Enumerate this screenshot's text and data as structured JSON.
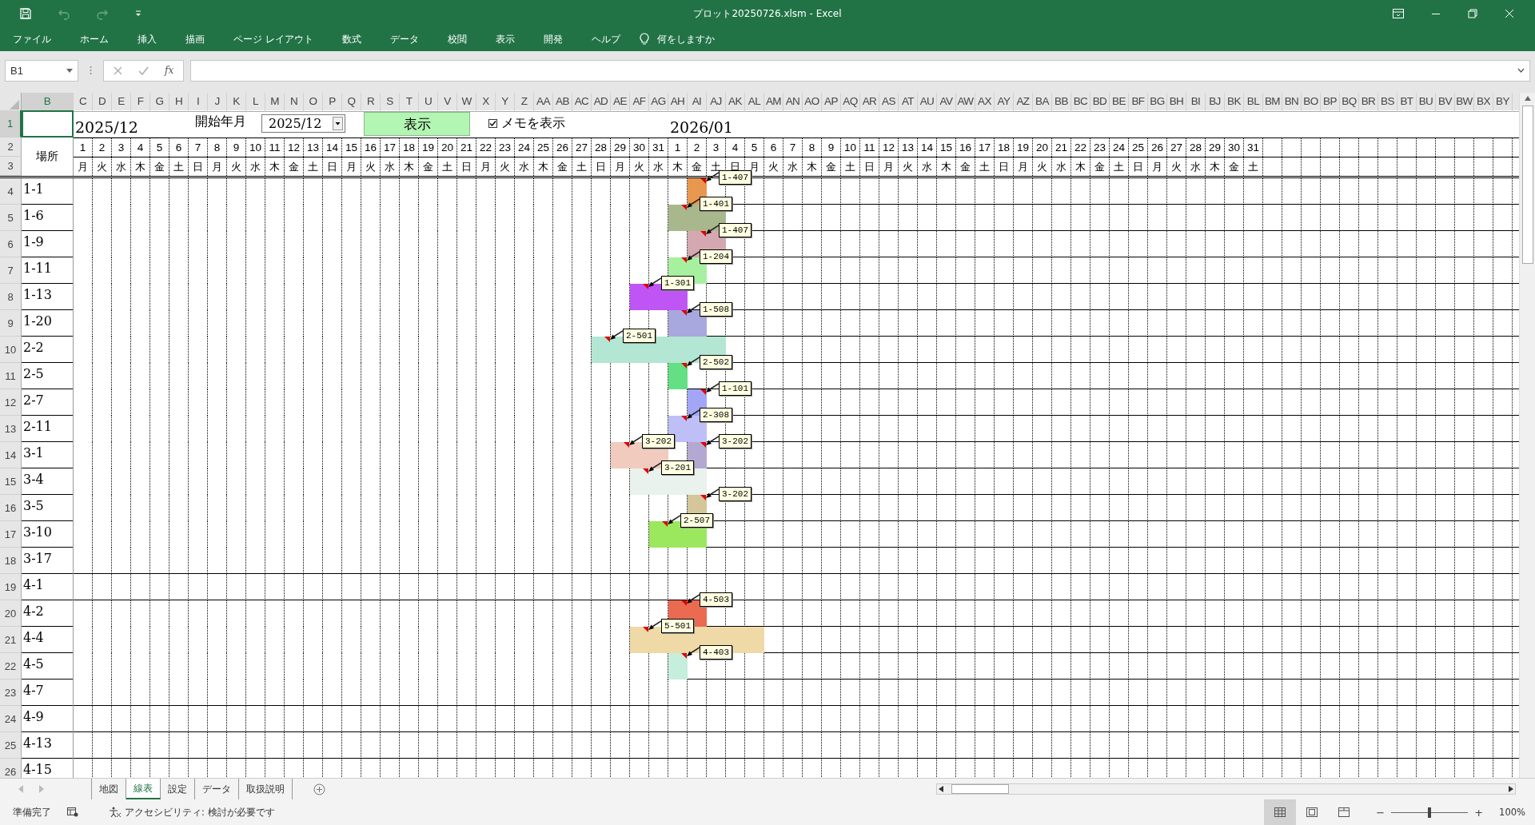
{
  "window": {
    "title": "プロット20250726.xlsm  -  Excel"
  },
  "menu": [
    "ファイル",
    "ホーム",
    "挿入",
    "描画",
    "ページ レイアウト",
    "数式",
    "データ",
    "校閲",
    "表示",
    "開発",
    "ヘルプ"
  ],
  "tell_me": "何をしますか",
  "name_box": "B1",
  "function_label": "fx",
  "column_headers": [
    "B",
    "C",
    "D",
    "E",
    "F",
    "G",
    "H",
    "I",
    "J",
    "K",
    "L",
    "M",
    "N",
    "O",
    "P",
    "Q",
    "R",
    "S",
    "T",
    "U",
    "V",
    "W",
    "X",
    "Y",
    "Z",
    "AA",
    "AB",
    "AC",
    "AD",
    "AE",
    "AF",
    "AG",
    "AH",
    "AI",
    "AJ",
    "AK",
    "AL",
    "AM",
    "AN",
    "AO",
    "AP",
    "AQ",
    "AR",
    "AS",
    "AT",
    "AU",
    "AV",
    "AW",
    "AX",
    "AY",
    "AZ",
    "BA",
    "BB",
    "BC",
    "BD",
    "BE",
    "BF",
    "BG",
    "BH",
    "BI",
    "BJ",
    "BK",
    "BL",
    "BM",
    "BN",
    "BO",
    "BP",
    "BQ",
    "BR",
    "BS",
    "BT",
    "BU",
    "BV",
    "BW",
    "BX",
    "BY"
  ],
  "row_headers": [
    "1",
    "2",
    "3",
    "4",
    "5",
    "6",
    "7",
    "8",
    "9",
    "10",
    "11",
    "12",
    "13",
    "14",
    "15",
    "16",
    "17",
    "18",
    "19",
    "20",
    "21",
    "22",
    "23",
    "24",
    "25",
    "26"
  ],
  "header_block": {
    "cell_selected": true,
    "month_start": "2025/12",
    "start_label": "開始年月",
    "start_select": "2025/12",
    "show_button": "表示",
    "memo_checkbox": {
      "label": "メモを表示",
      "checked": true
    },
    "month_next": "2026/01",
    "location_header": "場所",
    "day_numbers": [
      "1",
      "2",
      "3",
      "4",
      "5",
      "6",
      "7",
      "8",
      "9",
      "10",
      "11",
      "12",
      "13",
      "14",
      "15",
      "16",
      "17",
      "18",
      "19",
      "20",
      "21",
      "22",
      "23",
      "24",
      "25",
      "26",
      "27",
      "28",
      "29",
      "30",
      "31",
      "1",
      "2",
      "3",
      "4",
      "5",
      "6",
      "7",
      "8",
      "9",
      "10",
      "11",
      "12",
      "13",
      "14",
      "15",
      "16",
      "17",
      "18",
      "19",
      "20",
      "21",
      "22",
      "23",
      "24",
      "25",
      "26",
      "27",
      "28",
      "29",
      "30",
      "31"
    ],
    "weekdays": [
      "月",
      "火",
      "水",
      "木",
      "金",
      "土",
      "日",
      "月",
      "火",
      "水",
      "木",
      "金",
      "土",
      "日",
      "月",
      "火",
      "水",
      "木",
      "金",
      "土",
      "日",
      "月",
      "火",
      "水",
      "木",
      "金",
      "土",
      "日",
      "月",
      "火",
      "水",
      "木",
      "金",
      "土",
      "日",
      "月",
      "火",
      "水",
      "木",
      "金",
      "土",
      "日",
      "月",
      "火",
      "水",
      "木",
      "金",
      "土",
      "日",
      "月",
      "火",
      "水",
      "木",
      "金",
      "土",
      "日",
      "月",
      "火",
      "水",
      "木",
      "金",
      "土"
    ]
  },
  "locations": [
    {
      "label": "1-1",
      "cells": [
        {
          "color": "#ffffff"
        },
        {
          "color": "#ffffff"
        },
        {
          "color": "#ffffff"
        },
        {
          "color": "#ffffff"
        },
        {
          "color": "#ffffff"
        },
        {
          "color": "#ffffff"
        },
        {
          "color": "#ffffff"
        },
        {
          "color": "#ffffff"
        },
        {
          "color": "#ffffff"
        },
        {
          "color": "#ffffff"
        },
        {
          "color": "#ffffff"
        },
        {
          "color": "#ffffff"
        },
        {
          "color": "#ffffff"
        },
        {
          "color": "#ffffff"
        },
        {
          "color": "#ffffff"
        },
        {
          "color": "#ffffff"
        },
        {
          "color": "#ffffff"
        },
        {
          "color": "#ffffff"
        },
        {
          "color": "#ffffff"
        },
        {
          "color": "#ffffff"
        },
        {
          "color": "#ffffff"
        },
        {
          "color": "#ffffff"
        },
        {
          "color": "#ffffff"
        },
        {
          "color": "#ffffff"
        },
        {
          "color": "#ffffff"
        },
        {
          "color": "#ffffff"
        },
        {
          "color": "#ffffff"
        },
        {
          "color": "#ffffff"
        },
        {
          "color": "#ffffff"
        },
        {
          "color": "#ffffff"
        },
        {
          "color": "#ffffff"
        },
        {
          "color": "#ffffff"
        },
        {
          "color": "#e8984e",
          "memo": "1-407"
        }
      ]
    },
    {
      "label": "1-6",
      "cells": [
        {
          "color": "#ffffff"
        },
        {
          "color": "#ffffff"
        },
        {
          "color": "#ffffff"
        },
        {
          "color": "#ffffff"
        },
        {
          "color": "#ffffff"
        },
        {
          "color": "#ffffff"
        },
        {
          "color": "#ffffff"
        },
        {
          "color": "#ffffff"
        },
        {
          "color": "#ffffff"
        },
        {
          "color": "#ffffff"
        },
        {
          "color": "#ffffff"
        },
        {
          "color": "#ffffff"
        },
        {
          "color": "#ffffff"
        },
        {
          "color": "#ffffff"
        },
        {
          "color": "#ffffff"
        },
        {
          "color": "#ffffff"
        },
        {
          "color": "#ffffff"
        },
        {
          "color": "#ffffff"
        },
        {
          "color": "#ffffff"
        },
        {
          "color": "#ffffff"
        },
        {
          "color": "#ffffff"
        },
        {
          "color": "#ffffff"
        },
        {
          "color": "#ffffff"
        },
        {
          "color": "#ffffff"
        },
        {
          "color": "#ffffff"
        },
        {
          "color": "#ffffff"
        },
        {
          "color": "#ffffff"
        },
        {
          "color": "#ffffff"
        },
        {
          "color": "#ffffff"
        },
        {
          "color": "#ffffff"
        },
        {
          "color": "#ffffff"
        },
        {
          "color": "#a9b88c",
          "memo": "1-401"
        },
        {
          "color": "#a9b88c"
        },
        {
          "color": "#a9b88c"
        }
      ]
    },
    {
      "label": "1-9",
      "cells": [
        {
          "color": "#ffffff"
        },
        {
          "color": "#ffffff"
        },
        {
          "color": "#ffffff"
        },
        {
          "color": "#ffffff"
        },
        {
          "color": "#ffffff"
        },
        {
          "color": "#ffffff"
        },
        {
          "color": "#ffffff"
        },
        {
          "color": "#ffffff"
        },
        {
          "color": "#ffffff"
        },
        {
          "color": "#ffffff"
        },
        {
          "color": "#ffffff"
        },
        {
          "color": "#ffffff"
        },
        {
          "color": "#ffffff"
        },
        {
          "color": "#ffffff"
        },
        {
          "color": "#ffffff"
        },
        {
          "color": "#ffffff"
        },
        {
          "color": "#ffffff"
        },
        {
          "color": "#ffffff"
        },
        {
          "color": "#ffffff"
        },
        {
          "color": "#ffffff"
        },
        {
          "color": "#ffffff"
        },
        {
          "color": "#ffffff"
        },
        {
          "color": "#ffffff"
        },
        {
          "color": "#ffffff"
        },
        {
          "color": "#ffffff"
        },
        {
          "color": "#ffffff"
        },
        {
          "color": "#ffffff"
        },
        {
          "color": "#ffffff"
        },
        {
          "color": "#ffffff"
        },
        {
          "color": "#ffffff"
        },
        {
          "color": "#ffffff"
        },
        {
          "color": "#ffffff"
        },
        {
          "color": "#d5a7b0",
          "memo": "1-407"
        },
        {
          "color": "#d5a7b0"
        }
      ]
    },
    {
      "label": "1-11",
      "cells": [
        {
          "color": "#ffffff"
        },
        {
          "color": "#ffffff"
        },
        {
          "color": "#ffffff"
        },
        {
          "color": "#ffffff"
        },
        {
          "color": "#ffffff"
        },
        {
          "color": "#ffffff"
        },
        {
          "color": "#ffffff"
        },
        {
          "color": "#ffffff"
        },
        {
          "color": "#ffffff"
        },
        {
          "color": "#ffffff"
        },
        {
          "color": "#ffffff"
        },
        {
          "color": "#ffffff"
        },
        {
          "color": "#ffffff"
        },
        {
          "color": "#ffffff"
        },
        {
          "color": "#ffffff"
        },
        {
          "color": "#ffffff"
        },
        {
          "color": "#ffffff"
        },
        {
          "color": "#ffffff"
        },
        {
          "color": "#ffffff"
        },
        {
          "color": "#ffffff"
        },
        {
          "color": "#ffffff"
        },
        {
          "color": "#ffffff"
        },
        {
          "color": "#ffffff"
        },
        {
          "color": "#ffffff"
        },
        {
          "color": "#ffffff"
        },
        {
          "color": "#ffffff"
        },
        {
          "color": "#ffffff"
        },
        {
          "color": "#ffffff"
        },
        {
          "color": "#ffffff"
        },
        {
          "color": "#ffffff"
        },
        {
          "color": "#ffffff"
        },
        {
          "color": "#a6f0a0",
          "memo": "1-204"
        },
        {
          "color": "#a6f0a0"
        }
      ]
    },
    {
      "label": "1-13",
      "cells": [
        {
          "color": "#ffffff"
        },
        {
          "color": "#ffffff"
        },
        {
          "color": "#ffffff"
        },
        {
          "color": "#ffffff"
        },
        {
          "color": "#ffffff"
        },
        {
          "color": "#ffffff"
        },
        {
          "color": "#ffffff"
        },
        {
          "color": "#ffffff"
        },
        {
          "color": "#ffffff"
        },
        {
          "color": "#ffffff"
        },
        {
          "color": "#ffffff"
        },
        {
          "color": "#ffffff"
        },
        {
          "color": "#ffffff"
        },
        {
          "color": "#ffffff"
        },
        {
          "color": "#ffffff"
        },
        {
          "color": "#ffffff"
        },
        {
          "color": "#ffffff"
        },
        {
          "color": "#ffffff"
        },
        {
          "color": "#ffffff"
        },
        {
          "color": "#ffffff"
        },
        {
          "color": "#ffffff"
        },
        {
          "color": "#ffffff"
        },
        {
          "color": "#ffffff"
        },
        {
          "color": "#ffffff"
        },
        {
          "color": "#ffffff"
        },
        {
          "color": "#ffffff"
        },
        {
          "color": "#ffffff"
        },
        {
          "color": "#ffffff"
        },
        {
          "color": "#ffffff"
        },
        {
          "color": "#bf55f5",
          "memo": "1-301"
        },
        {
          "color": "#bf55f5"
        },
        {
          "color": "#bf55f5"
        }
      ]
    },
    {
      "label": "1-20",
      "cells": [
        {
          "color": "#ffffff"
        },
        {
          "color": "#ffffff"
        },
        {
          "color": "#ffffff"
        },
        {
          "color": "#ffffff"
        },
        {
          "color": "#ffffff"
        },
        {
          "color": "#ffffff"
        },
        {
          "color": "#ffffff"
        },
        {
          "color": "#ffffff"
        },
        {
          "color": "#ffffff"
        },
        {
          "color": "#ffffff"
        },
        {
          "color": "#ffffff"
        },
        {
          "color": "#ffffff"
        },
        {
          "color": "#ffffff"
        },
        {
          "color": "#ffffff"
        },
        {
          "color": "#ffffff"
        },
        {
          "color": "#ffffff"
        },
        {
          "color": "#ffffff"
        },
        {
          "color": "#ffffff"
        },
        {
          "color": "#ffffff"
        },
        {
          "color": "#ffffff"
        },
        {
          "color": "#ffffff"
        },
        {
          "color": "#ffffff"
        },
        {
          "color": "#ffffff"
        },
        {
          "color": "#ffffff"
        },
        {
          "color": "#ffffff"
        },
        {
          "color": "#ffffff"
        },
        {
          "color": "#ffffff"
        },
        {
          "color": "#ffffff"
        },
        {
          "color": "#ffffff"
        },
        {
          "color": "#ffffff"
        },
        {
          "color": "#ffffff"
        },
        {
          "color": "#a8a8df",
          "memo": "1-508"
        },
        {
          "color": "#a8a8df"
        }
      ]
    },
    {
      "label": "2-2",
      "cells": [
        {
          "color": "#ffffff"
        },
        {
          "color": "#ffffff"
        },
        {
          "color": "#ffffff"
        },
        {
          "color": "#ffffff"
        },
        {
          "color": "#ffffff"
        },
        {
          "color": "#ffffff"
        },
        {
          "color": "#ffffff"
        },
        {
          "color": "#ffffff"
        },
        {
          "color": "#ffffff"
        },
        {
          "color": "#ffffff"
        },
        {
          "color": "#ffffff"
        },
        {
          "color": "#ffffff"
        },
        {
          "color": "#ffffff"
        },
        {
          "color": "#ffffff"
        },
        {
          "color": "#ffffff"
        },
        {
          "color": "#ffffff"
        },
        {
          "color": "#ffffff"
        },
        {
          "color": "#ffffff"
        },
        {
          "color": "#ffffff"
        },
        {
          "color": "#ffffff"
        },
        {
          "color": "#ffffff"
        },
        {
          "color": "#ffffff"
        },
        {
          "color": "#ffffff"
        },
        {
          "color": "#ffffff"
        },
        {
          "color": "#ffffff"
        },
        {
          "color": "#ffffff"
        },
        {
          "color": "#ffffff"
        },
        {
          "color": "#b3e6d3",
          "memo": "2-501"
        },
        {
          "color": "#b3e6d3"
        },
        {
          "color": "#b3e6d3"
        },
        {
          "color": "#b3e6d3"
        },
        {
          "color": "#b3e6d3"
        },
        {
          "color": "#b3e6d3"
        },
        {
          "color": "#b3e6d3"
        }
      ]
    },
    {
      "label": "2-5",
      "cells": [
        {
          "color": "#ffffff"
        },
        {
          "color": "#ffffff"
        },
        {
          "color": "#ffffff"
        },
        {
          "color": "#ffffff"
        },
        {
          "color": "#ffffff"
        },
        {
          "color": "#ffffff"
        },
        {
          "color": "#ffffff"
        },
        {
          "color": "#ffffff"
        },
        {
          "color": "#ffffff"
        },
        {
          "color": "#ffffff"
        },
        {
          "color": "#ffffff"
        },
        {
          "color": "#ffffff"
        },
        {
          "color": "#ffffff"
        },
        {
          "color": "#ffffff"
        },
        {
          "color": "#ffffff"
        },
        {
          "color": "#ffffff"
        },
        {
          "color": "#ffffff"
        },
        {
          "color": "#ffffff"
        },
        {
          "color": "#ffffff"
        },
        {
          "color": "#ffffff"
        },
        {
          "color": "#ffffff"
        },
        {
          "color": "#ffffff"
        },
        {
          "color": "#ffffff"
        },
        {
          "color": "#ffffff"
        },
        {
          "color": "#ffffff"
        },
        {
          "color": "#ffffff"
        },
        {
          "color": "#ffffff"
        },
        {
          "color": "#ffffff"
        },
        {
          "color": "#ffffff"
        },
        {
          "color": "#ffffff"
        },
        {
          "color": "#ffffff"
        },
        {
          "color": "#63e083",
          "memo": "2-502"
        }
      ]
    },
    {
      "label": "2-7",
      "cells": [
        {
          "color": "#ffffff"
        },
        {
          "color": "#ffffff"
        },
        {
          "color": "#ffffff"
        },
        {
          "color": "#ffffff"
        },
        {
          "color": "#ffffff"
        },
        {
          "color": "#ffffff"
        },
        {
          "color": "#ffffff"
        },
        {
          "color": "#ffffff"
        },
        {
          "color": "#ffffff"
        },
        {
          "color": "#ffffff"
        },
        {
          "color": "#ffffff"
        },
        {
          "color": "#ffffff"
        },
        {
          "color": "#ffffff"
        },
        {
          "color": "#ffffff"
        },
        {
          "color": "#ffffff"
        },
        {
          "color": "#ffffff"
        },
        {
          "color": "#ffffff"
        },
        {
          "color": "#ffffff"
        },
        {
          "color": "#ffffff"
        },
        {
          "color": "#ffffff"
        },
        {
          "color": "#ffffff"
        },
        {
          "color": "#ffffff"
        },
        {
          "color": "#ffffff"
        },
        {
          "color": "#ffffff"
        },
        {
          "color": "#ffffff"
        },
        {
          "color": "#ffffff"
        },
        {
          "color": "#ffffff"
        },
        {
          "color": "#ffffff"
        },
        {
          "color": "#ffffff"
        },
        {
          "color": "#ffffff"
        },
        {
          "color": "#ffffff"
        },
        {
          "color": "#ffffff"
        },
        {
          "color": "#a3a6f7",
          "memo": "1-101"
        }
      ]
    },
    {
      "label": "2-11",
      "cells": [
        {
          "color": "#ffffff"
        },
        {
          "color": "#ffffff"
        },
        {
          "color": "#ffffff"
        },
        {
          "color": "#ffffff"
        },
        {
          "color": "#ffffff"
        },
        {
          "color": "#ffffff"
        },
        {
          "color": "#ffffff"
        },
        {
          "color": "#ffffff"
        },
        {
          "color": "#ffffff"
        },
        {
          "color": "#ffffff"
        },
        {
          "color": "#ffffff"
        },
        {
          "color": "#ffffff"
        },
        {
          "color": "#ffffff"
        },
        {
          "color": "#ffffff"
        },
        {
          "color": "#ffffff"
        },
        {
          "color": "#ffffff"
        },
        {
          "color": "#ffffff"
        },
        {
          "color": "#ffffff"
        },
        {
          "color": "#ffffff"
        },
        {
          "color": "#ffffff"
        },
        {
          "color": "#ffffff"
        },
        {
          "color": "#ffffff"
        },
        {
          "color": "#ffffff"
        },
        {
          "color": "#ffffff"
        },
        {
          "color": "#ffffff"
        },
        {
          "color": "#ffffff"
        },
        {
          "color": "#ffffff"
        },
        {
          "color": "#ffffff"
        },
        {
          "color": "#ffffff"
        },
        {
          "color": "#ffffff"
        },
        {
          "color": "#ffffff"
        },
        {
          "color": "#bfbff7",
          "memo": "2-308"
        },
        {
          "color": "#bfbff7"
        }
      ]
    },
    {
      "label": "3-1",
      "cells": [
        {
          "color": "#ffffff"
        },
        {
          "color": "#ffffff"
        },
        {
          "color": "#ffffff"
        },
        {
          "color": "#ffffff"
        },
        {
          "color": "#ffffff"
        },
        {
          "color": "#ffffff"
        },
        {
          "color": "#ffffff"
        },
        {
          "color": "#ffffff"
        },
        {
          "color": "#ffffff"
        },
        {
          "color": "#ffffff"
        },
        {
          "color": "#ffffff"
        },
        {
          "color": "#ffffff"
        },
        {
          "color": "#ffffff"
        },
        {
          "color": "#ffffff"
        },
        {
          "color": "#ffffff"
        },
        {
          "color": "#ffffff"
        },
        {
          "color": "#ffffff"
        },
        {
          "color": "#ffffff"
        },
        {
          "color": "#ffffff"
        },
        {
          "color": "#ffffff"
        },
        {
          "color": "#ffffff"
        },
        {
          "color": "#ffffff"
        },
        {
          "color": "#ffffff"
        },
        {
          "color": "#ffffff"
        },
        {
          "color": "#ffffff"
        },
        {
          "color": "#ffffff"
        },
        {
          "color": "#ffffff"
        },
        {
          "color": "#ffffff"
        },
        {
          "color": "#f0cbbe",
          "memo": "3-202"
        },
        {
          "color": "#f0cbbe"
        },
        {
          "color": "#f0cbbe"
        },
        {
          "color": "#ffffff"
        },
        {
          "color": "#b3a8d2",
          "memo": "3-202"
        }
      ]
    },
    {
      "label": "3-4",
      "cells": [
        {
          "color": "#ffffff"
        },
        {
          "color": "#ffffff"
        },
        {
          "color": "#ffffff"
        },
        {
          "color": "#ffffff"
        },
        {
          "color": "#ffffff"
        },
        {
          "color": "#ffffff"
        },
        {
          "color": "#ffffff"
        },
        {
          "color": "#ffffff"
        },
        {
          "color": "#ffffff"
        },
        {
          "color": "#ffffff"
        },
        {
          "color": "#ffffff"
        },
        {
          "color": "#ffffff"
        },
        {
          "color": "#ffffff"
        },
        {
          "color": "#ffffff"
        },
        {
          "color": "#ffffff"
        },
        {
          "color": "#ffffff"
        },
        {
          "color": "#ffffff"
        },
        {
          "color": "#ffffff"
        },
        {
          "color": "#ffffff"
        },
        {
          "color": "#ffffff"
        },
        {
          "color": "#ffffff"
        },
        {
          "color": "#ffffff"
        },
        {
          "color": "#ffffff"
        },
        {
          "color": "#ffffff"
        },
        {
          "color": "#ffffff"
        },
        {
          "color": "#ffffff"
        },
        {
          "color": "#ffffff"
        },
        {
          "color": "#ffffff"
        },
        {
          "color": "#ffffff"
        },
        {
          "color": "#e9f2ec",
          "memo": "3-201"
        },
        {
          "color": "#e9f2ec"
        },
        {
          "color": "#e9f2ec"
        },
        {
          "color": "#e9f2ec"
        }
      ]
    },
    {
      "label": "3-5",
      "cells": [
        {
          "color": "#ffffff"
        },
        {
          "color": "#ffffff"
        },
        {
          "color": "#ffffff"
        },
        {
          "color": "#ffffff"
        },
        {
          "color": "#ffffff"
        },
        {
          "color": "#ffffff"
        },
        {
          "color": "#ffffff"
        },
        {
          "color": "#ffffff"
        },
        {
          "color": "#ffffff"
        },
        {
          "color": "#ffffff"
        },
        {
          "color": "#ffffff"
        },
        {
          "color": "#ffffff"
        },
        {
          "color": "#ffffff"
        },
        {
          "color": "#ffffff"
        },
        {
          "color": "#ffffff"
        },
        {
          "color": "#ffffff"
        },
        {
          "color": "#ffffff"
        },
        {
          "color": "#ffffff"
        },
        {
          "color": "#ffffff"
        },
        {
          "color": "#ffffff"
        },
        {
          "color": "#ffffff"
        },
        {
          "color": "#ffffff"
        },
        {
          "color": "#ffffff"
        },
        {
          "color": "#ffffff"
        },
        {
          "color": "#ffffff"
        },
        {
          "color": "#ffffff"
        },
        {
          "color": "#ffffff"
        },
        {
          "color": "#ffffff"
        },
        {
          "color": "#ffffff"
        },
        {
          "color": "#ffffff"
        },
        {
          "color": "#ffffff"
        },
        {
          "color": "#ffffff"
        },
        {
          "color": "#d4c59a",
          "memo": "3-202"
        }
      ]
    },
    {
      "label": "3-10",
      "cells": [
        {
          "color": "#ffffff"
        },
        {
          "color": "#ffffff"
        },
        {
          "color": "#ffffff"
        },
        {
          "color": "#ffffff"
        },
        {
          "color": "#ffffff"
        },
        {
          "color": "#ffffff"
        },
        {
          "color": "#ffffff"
        },
        {
          "color": "#ffffff"
        },
        {
          "color": "#ffffff"
        },
        {
          "color": "#ffffff"
        },
        {
          "color": "#ffffff"
        },
        {
          "color": "#ffffff"
        },
        {
          "color": "#ffffff"
        },
        {
          "color": "#ffffff"
        },
        {
          "color": "#ffffff"
        },
        {
          "color": "#ffffff"
        },
        {
          "color": "#ffffff"
        },
        {
          "color": "#ffffff"
        },
        {
          "color": "#ffffff"
        },
        {
          "color": "#ffffff"
        },
        {
          "color": "#ffffff"
        },
        {
          "color": "#ffffff"
        },
        {
          "color": "#ffffff"
        },
        {
          "color": "#ffffff"
        },
        {
          "color": "#ffffff"
        },
        {
          "color": "#ffffff"
        },
        {
          "color": "#ffffff"
        },
        {
          "color": "#ffffff"
        },
        {
          "color": "#ffffff"
        },
        {
          "color": "#ffffff"
        },
        {
          "color": "#9be85f",
          "memo": "2-507"
        },
        {
          "color": "#9be85f"
        },
        {
          "color": "#9be85f"
        }
      ]
    },
    {
      "label": "3-17"
    },
    {
      "label": "4-1"
    },
    {
      "label": "4-2",
      "cells": [
        {
          "color": "#ffffff"
        },
        {
          "color": "#ffffff"
        },
        {
          "color": "#ffffff"
        },
        {
          "color": "#ffffff"
        },
        {
          "color": "#ffffff"
        },
        {
          "color": "#ffffff"
        },
        {
          "color": "#ffffff"
        },
        {
          "color": "#ffffff"
        },
        {
          "color": "#ffffff"
        },
        {
          "color": "#ffffff"
        },
        {
          "color": "#ffffff"
        },
        {
          "color": "#ffffff"
        },
        {
          "color": "#ffffff"
        },
        {
          "color": "#ffffff"
        },
        {
          "color": "#ffffff"
        },
        {
          "color": "#ffffff"
        },
        {
          "color": "#ffffff"
        },
        {
          "color": "#ffffff"
        },
        {
          "color": "#ffffff"
        },
        {
          "color": "#ffffff"
        },
        {
          "color": "#ffffff"
        },
        {
          "color": "#ffffff"
        },
        {
          "color": "#ffffff"
        },
        {
          "color": "#ffffff"
        },
        {
          "color": "#ffffff"
        },
        {
          "color": "#ffffff"
        },
        {
          "color": "#ffffff"
        },
        {
          "color": "#ffffff"
        },
        {
          "color": "#ffffff"
        },
        {
          "color": "#ffffff"
        },
        {
          "color": "#ffffff"
        },
        {
          "color": "#ea6a52",
          "memo": "4-503"
        },
        {
          "color": "#ea6a52"
        }
      ]
    },
    {
      "label": "4-4",
      "cells": [
        {
          "color": "#ffffff"
        },
        {
          "color": "#ffffff"
        },
        {
          "color": "#ffffff"
        },
        {
          "color": "#ffffff"
        },
        {
          "color": "#ffffff"
        },
        {
          "color": "#ffffff"
        },
        {
          "color": "#ffffff"
        },
        {
          "color": "#ffffff"
        },
        {
          "color": "#ffffff"
        },
        {
          "color": "#ffffff"
        },
        {
          "color": "#ffffff"
        },
        {
          "color": "#ffffff"
        },
        {
          "color": "#ffffff"
        },
        {
          "color": "#ffffff"
        },
        {
          "color": "#ffffff"
        },
        {
          "color": "#ffffff"
        },
        {
          "color": "#ffffff"
        },
        {
          "color": "#ffffff"
        },
        {
          "color": "#ffffff"
        },
        {
          "color": "#ffffff"
        },
        {
          "color": "#ffffff"
        },
        {
          "color": "#ffffff"
        },
        {
          "color": "#ffffff"
        },
        {
          "color": "#ffffff"
        },
        {
          "color": "#ffffff"
        },
        {
          "color": "#ffffff"
        },
        {
          "color": "#ffffff"
        },
        {
          "color": "#ffffff"
        },
        {
          "color": "#ffffff"
        },
        {
          "color": "#efdaa7",
          "memo": "5-501"
        },
        {
          "color": "#efdaa7"
        },
        {
          "color": "#efdaa7"
        },
        {
          "color": "#efdaa7"
        },
        {
          "color": "#efdaa7"
        },
        {
          "color": "#efdaa7"
        },
        {
          "color": "#efdaa7"
        }
      ]
    },
    {
      "label": "4-5",
      "cells": [
        {
          "color": "#ffffff"
        },
        {
          "color": "#ffffff"
        },
        {
          "color": "#ffffff"
        },
        {
          "color": "#ffffff"
        },
        {
          "color": "#ffffff"
        },
        {
          "color": "#ffffff"
        },
        {
          "color": "#ffffff"
        },
        {
          "color": "#ffffff"
        },
        {
          "color": "#ffffff"
        },
        {
          "color": "#ffffff"
        },
        {
          "color": "#ffffff"
        },
        {
          "color": "#ffffff"
        },
        {
          "color": "#ffffff"
        },
        {
          "color": "#ffffff"
        },
        {
          "color": "#ffffff"
        },
        {
          "color": "#ffffff"
        },
        {
          "color": "#ffffff"
        },
        {
          "color": "#ffffff"
        },
        {
          "color": "#ffffff"
        },
        {
          "color": "#ffffff"
        },
        {
          "color": "#ffffff"
        },
        {
          "color": "#ffffff"
        },
        {
          "color": "#ffffff"
        },
        {
          "color": "#ffffff"
        },
        {
          "color": "#ffffff"
        },
        {
          "color": "#ffffff"
        },
        {
          "color": "#ffffff"
        },
        {
          "color": "#ffffff"
        },
        {
          "color": "#ffffff"
        },
        {
          "color": "#ffffff"
        },
        {
          "color": "#ffffff"
        },
        {
          "color": "#c5eedc",
          "memo": "4-403"
        }
      ]
    },
    {
      "label": "4-7"
    },
    {
      "label": "4-9"
    },
    {
      "label": "4-13"
    },
    {
      "label": "4-15"
    }
  ],
  "sheet_tabs": [
    {
      "label": "地図",
      "selected": false
    },
    {
      "label": "線表",
      "selected": true
    },
    {
      "label": "設定",
      "selected": false
    },
    {
      "label": "データ",
      "selected": false
    },
    {
      "label": "取扱説明",
      "selected": false
    }
  ],
  "status": {
    "ready": "準備完了",
    "accessibility": "アクセシビリティ: 検討が必要です",
    "views": [
      {
        "kind": "normal",
        "selected": true
      },
      {
        "kind": "page_layout",
        "selected": false
      },
      {
        "kind": "page_break",
        "selected": false
      }
    ],
    "zoom_out": "−",
    "zoom_in": "+",
    "zoom": {
      "level": 0.5,
      "reading": "100%"
    }
  }
}
